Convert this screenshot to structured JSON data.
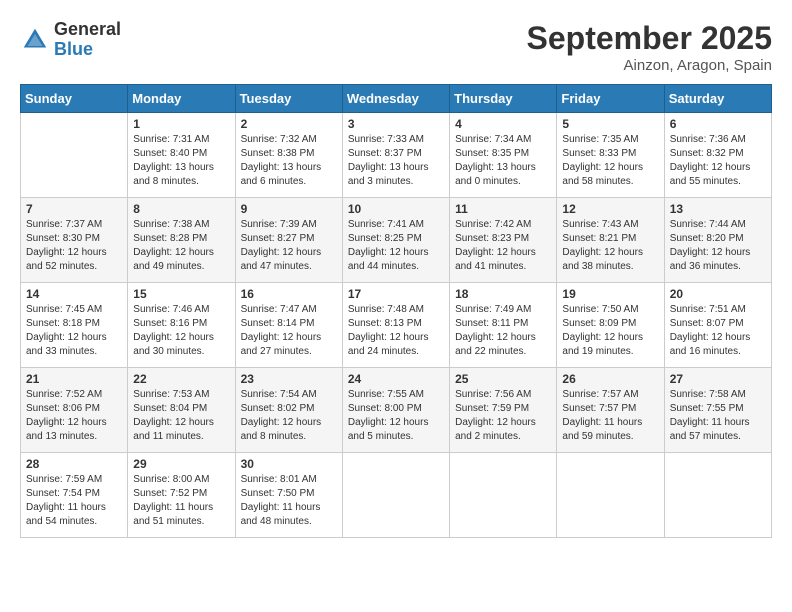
{
  "header": {
    "logo_general": "General",
    "logo_blue": "Blue",
    "month_title": "September 2025",
    "location": "Ainzon, Aragon, Spain"
  },
  "days_of_week": [
    "Sunday",
    "Monday",
    "Tuesday",
    "Wednesday",
    "Thursday",
    "Friday",
    "Saturday"
  ],
  "weeks": [
    [
      {
        "day": "",
        "info": ""
      },
      {
        "day": "1",
        "info": "Sunrise: 7:31 AM\nSunset: 8:40 PM\nDaylight: 13 hours\nand 8 minutes."
      },
      {
        "day": "2",
        "info": "Sunrise: 7:32 AM\nSunset: 8:38 PM\nDaylight: 13 hours\nand 6 minutes."
      },
      {
        "day": "3",
        "info": "Sunrise: 7:33 AM\nSunset: 8:37 PM\nDaylight: 13 hours\nand 3 minutes."
      },
      {
        "day": "4",
        "info": "Sunrise: 7:34 AM\nSunset: 8:35 PM\nDaylight: 13 hours\nand 0 minutes."
      },
      {
        "day": "5",
        "info": "Sunrise: 7:35 AM\nSunset: 8:33 PM\nDaylight: 12 hours\nand 58 minutes."
      },
      {
        "day": "6",
        "info": "Sunrise: 7:36 AM\nSunset: 8:32 PM\nDaylight: 12 hours\nand 55 minutes."
      }
    ],
    [
      {
        "day": "7",
        "info": "Sunrise: 7:37 AM\nSunset: 8:30 PM\nDaylight: 12 hours\nand 52 minutes."
      },
      {
        "day": "8",
        "info": "Sunrise: 7:38 AM\nSunset: 8:28 PM\nDaylight: 12 hours\nand 49 minutes."
      },
      {
        "day": "9",
        "info": "Sunrise: 7:39 AM\nSunset: 8:27 PM\nDaylight: 12 hours\nand 47 minutes."
      },
      {
        "day": "10",
        "info": "Sunrise: 7:41 AM\nSunset: 8:25 PM\nDaylight: 12 hours\nand 44 minutes."
      },
      {
        "day": "11",
        "info": "Sunrise: 7:42 AM\nSunset: 8:23 PM\nDaylight: 12 hours\nand 41 minutes."
      },
      {
        "day": "12",
        "info": "Sunrise: 7:43 AM\nSunset: 8:21 PM\nDaylight: 12 hours\nand 38 minutes."
      },
      {
        "day": "13",
        "info": "Sunrise: 7:44 AM\nSunset: 8:20 PM\nDaylight: 12 hours\nand 36 minutes."
      }
    ],
    [
      {
        "day": "14",
        "info": "Sunrise: 7:45 AM\nSunset: 8:18 PM\nDaylight: 12 hours\nand 33 minutes."
      },
      {
        "day": "15",
        "info": "Sunrise: 7:46 AM\nSunset: 8:16 PM\nDaylight: 12 hours\nand 30 minutes."
      },
      {
        "day": "16",
        "info": "Sunrise: 7:47 AM\nSunset: 8:14 PM\nDaylight: 12 hours\nand 27 minutes."
      },
      {
        "day": "17",
        "info": "Sunrise: 7:48 AM\nSunset: 8:13 PM\nDaylight: 12 hours\nand 24 minutes."
      },
      {
        "day": "18",
        "info": "Sunrise: 7:49 AM\nSunset: 8:11 PM\nDaylight: 12 hours\nand 22 minutes."
      },
      {
        "day": "19",
        "info": "Sunrise: 7:50 AM\nSunset: 8:09 PM\nDaylight: 12 hours\nand 19 minutes."
      },
      {
        "day": "20",
        "info": "Sunrise: 7:51 AM\nSunset: 8:07 PM\nDaylight: 12 hours\nand 16 minutes."
      }
    ],
    [
      {
        "day": "21",
        "info": "Sunrise: 7:52 AM\nSunset: 8:06 PM\nDaylight: 12 hours\nand 13 minutes."
      },
      {
        "day": "22",
        "info": "Sunrise: 7:53 AM\nSunset: 8:04 PM\nDaylight: 12 hours\nand 11 minutes."
      },
      {
        "day": "23",
        "info": "Sunrise: 7:54 AM\nSunset: 8:02 PM\nDaylight: 12 hours\nand 8 minutes."
      },
      {
        "day": "24",
        "info": "Sunrise: 7:55 AM\nSunset: 8:00 PM\nDaylight: 12 hours\nand 5 minutes."
      },
      {
        "day": "25",
        "info": "Sunrise: 7:56 AM\nSunset: 7:59 PM\nDaylight: 12 hours\nand 2 minutes."
      },
      {
        "day": "26",
        "info": "Sunrise: 7:57 AM\nSunset: 7:57 PM\nDaylight: 11 hours\nand 59 minutes."
      },
      {
        "day": "27",
        "info": "Sunrise: 7:58 AM\nSunset: 7:55 PM\nDaylight: 11 hours\nand 57 minutes."
      }
    ],
    [
      {
        "day": "28",
        "info": "Sunrise: 7:59 AM\nSunset: 7:54 PM\nDaylight: 11 hours\nand 54 minutes."
      },
      {
        "day": "29",
        "info": "Sunrise: 8:00 AM\nSunset: 7:52 PM\nDaylight: 11 hours\nand 51 minutes."
      },
      {
        "day": "30",
        "info": "Sunrise: 8:01 AM\nSunset: 7:50 PM\nDaylight: 11 hours\nand 48 minutes."
      },
      {
        "day": "",
        "info": ""
      },
      {
        "day": "",
        "info": ""
      },
      {
        "day": "",
        "info": ""
      },
      {
        "day": "",
        "info": ""
      }
    ]
  ]
}
